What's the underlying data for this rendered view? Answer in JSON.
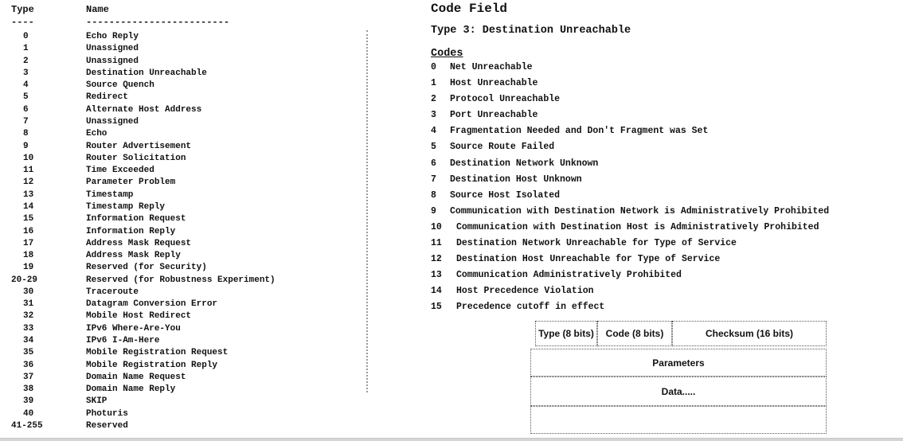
{
  "type_table": {
    "header_type": "Type",
    "header_name": "Name",
    "dash_type": "----",
    "dash_name": "-------------------------",
    "rows": [
      {
        "type": "0",
        "name": "Echo Reply"
      },
      {
        "type": "1",
        "name": "Unassigned"
      },
      {
        "type": "2",
        "name": "Unassigned"
      },
      {
        "type": "3",
        "name": "Destination Unreachable"
      },
      {
        "type": "4",
        "name": "Source Quench"
      },
      {
        "type": "5",
        "name": "Redirect"
      },
      {
        "type": "6",
        "name": "Alternate Host Address"
      },
      {
        "type": "7",
        "name": "Unassigned"
      },
      {
        "type": "8",
        "name": "Echo"
      },
      {
        "type": "9",
        "name": "Router Advertisement"
      },
      {
        "type": "10",
        "name": "Router Solicitation"
      },
      {
        "type": "11",
        "name": "Time Exceeded"
      },
      {
        "type": "12",
        "name": "Parameter Problem"
      },
      {
        "type": "13",
        "name": "Timestamp"
      },
      {
        "type": "14",
        "name": "Timestamp Reply"
      },
      {
        "type": "15",
        "name": "Information Request"
      },
      {
        "type": "16",
        "name": "Information Reply"
      },
      {
        "type": "17",
        "name": "Address Mask Request"
      },
      {
        "type": "18",
        "name": "Address Mask Reply"
      },
      {
        "type": "19",
        "name": "Reserved (for Security)"
      },
      {
        "type": "20-29",
        "name": "Reserved (for Robustness Experiment)"
      },
      {
        "type": "30",
        "name": "Traceroute"
      },
      {
        "type": "31",
        "name": "Datagram Conversion Error"
      },
      {
        "type": "32",
        "name": "Mobile Host Redirect"
      },
      {
        "type": "33",
        "name": "IPv6 Where-Are-You"
      },
      {
        "type": "34",
        "name": "IPv6 I-Am-Here"
      },
      {
        "type": "35",
        "name": "Mobile Registration Request"
      },
      {
        "type": "36",
        "name": "Mobile Registration Reply"
      },
      {
        "type": "37",
        "name": "Domain Name Request"
      },
      {
        "type": "38",
        "name": "Domain Name Reply"
      },
      {
        "type": "39",
        "name": "SKIP"
      },
      {
        "type": "40",
        "name": "Photuris"
      },
      {
        "type": "41-255",
        "name": "Reserved"
      }
    ]
  },
  "code_field": {
    "title": "Code Field",
    "type_line": "Type 3: Destination Unreachable",
    "codes_heading": "Codes",
    "codes": [
      {
        "code": "0",
        "text": "Net Unreachable"
      },
      {
        "code": "1",
        "text": "Host Unreachable"
      },
      {
        "code": "2",
        "text": "Protocol Unreachable"
      },
      {
        "code": "3",
        "text": "Port Unreachable"
      },
      {
        "code": "4",
        "text": "Fragmentation Needed and Don't Fragment was Set"
      },
      {
        "code": "5",
        "text": "Source Route Failed"
      },
      {
        "code": "6",
        "text": "Destination Network Unknown"
      },
      {
        "code": "7",
        "text": "Destination Host Unknown"
      },
      {
        "code": "8",
        "text": "Source Host Isolated"
      },
      {
        "code": "9",
        "text": "Communication with Destination Network is Administratively Prohibited"
      },
      {
        "code": "10",
        "text": "Communication with Destination Host is Administratively Prohibited"
      },
      {
        "code": "11",
        "text": "Destination Network Unreachable for Type of Service"
      },
      {
        "code": "12",
        "text": "Destination Host Unreachable for Type of Service"
      },
      {
        "code": "13",
        "text": "Communication Administratively Prohibited"
      },
      {
        "code": "14",
        "text": "Host Precedence Violation"
      },
      {
        "code": "15",
        "text": "Precedence cutoff in effect"
      }
    ]
  },
  "header_diagram": {
    "type_field": "Type (8 bits)",
    "code_field": "Code (8 bits)",
    "checksum_field": "Checksum (16 bits)",
    "parameters": "Parameters",
    "data": "Data....."
  }
}
